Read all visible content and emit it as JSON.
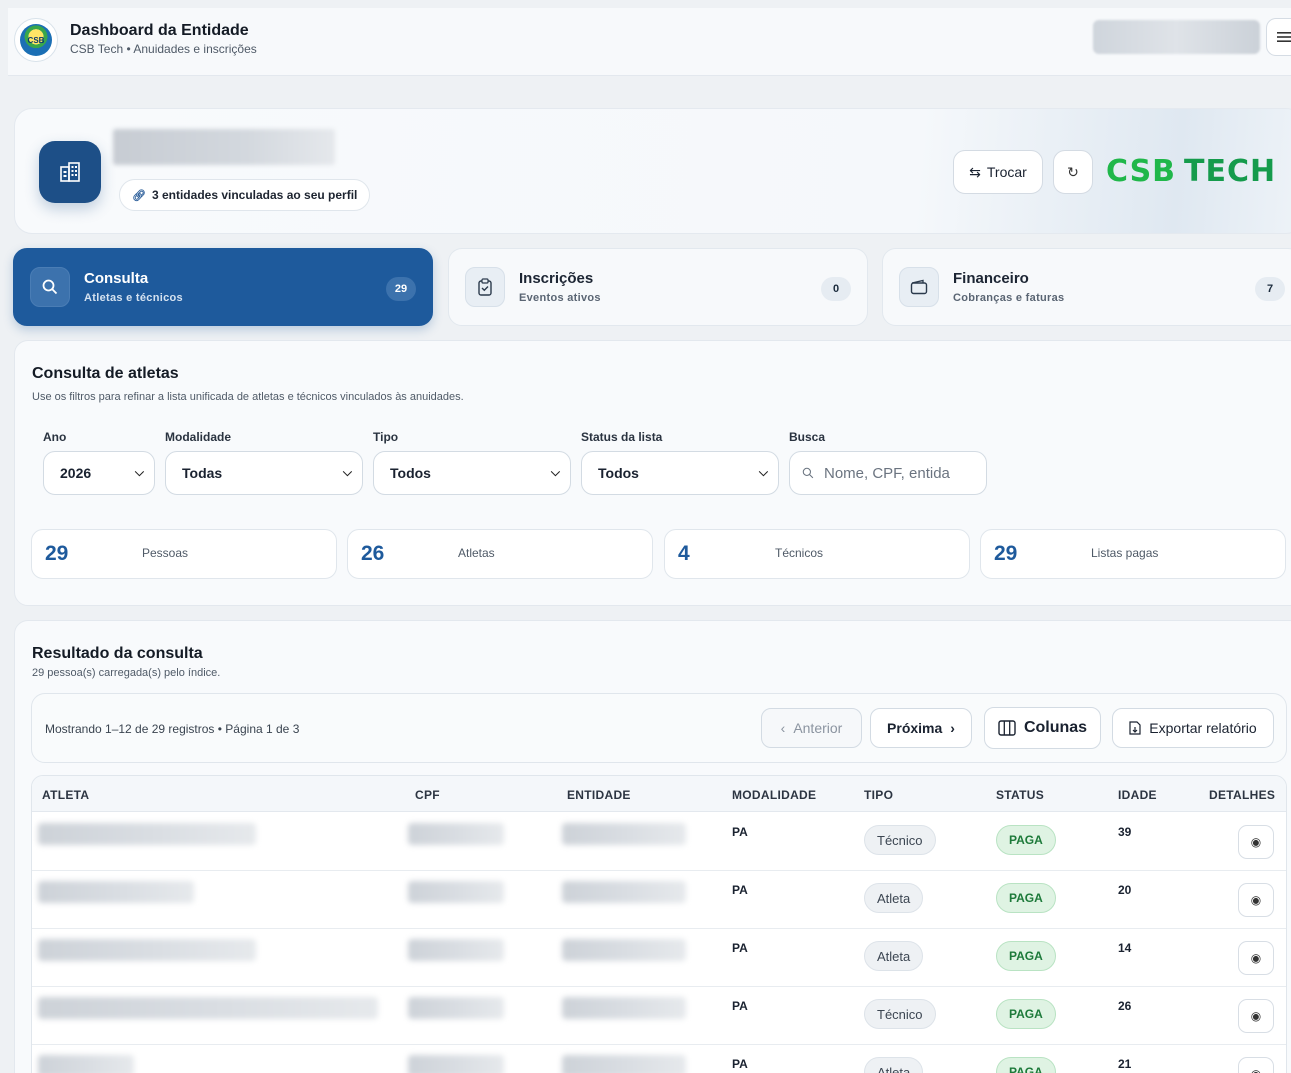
{
  "header": {
    "title": "Dashboard da Entidade",
    "subtitle": "CSB Tech • Anuidades e inscrições",
    "logo_text": "CSB",
    "menu_icon": "hamburger-icon"
  },
  "entity": {
    "linked_label": "3 entidades vinculadas ao seu perfil",
    "switch_label": "Trocar",
    "brand_left": "CSB",
    "brand_right": "TECH",
    "brand_color": "#20b74a"
  },
  "tabs": [
    {
      "title": "Consulta",
      "subtitle": "Atletas e técnicos",
      "count": "29",
      "icon": "search-icon",
      "active": true
    },
    {
      "title": "Inscrições",
      "subtitle": "Eventos ativos",
      "count": "0",
      "icon": "clipboard-check-icon",
      "active": false
    },
    {
      "title": "Financeiro",
      "subtitle": "Cobranças e faturas",
      "count": "7",
      "icon": "wallet-icon",
      "active": false
    }
  ],
  "consulta": {
    "title": "Consulta de atletas",
    "description": "Use os filtros para refinar a lista unificada de atletas e técnicos vinculados às anuidades.",
    "filters": {
      "ano": {
        "label": "Ano",
        "value": "2026"
      },
      "modalidade": {
        "label": "Modalidade",
        "value": "Todas"
      },
      "tipo": {
        "label": "Tipo",
        "value": "Todos"
      },
      "status": {
        "label": "Status da lista",
        "value": "Todos"
      },
      "busca": {
        "label": "Busca",
        "placeholder": "Nome, CPF, entida"
      }
    },
    "stats": [
      {
        "value": "29",
        "label": "Pessoas"
      },
      {
        "value": "26",
        "label": "Atletas"
      },
      {
        "value": "4",
        "label": "Técnicos"
      },
      {
        "value": "29",
        "label": "Listas pagas"
      }
    ]
  },
  "result": {
    "title": "Resultado da consulta",
    "description": "29 pessoa(s) carregada(s) pelo índice.",
    "toolbar": {
      "info": "Mostrando 1–12 de 29 registros • Página 1 de 3",
      "prev_label": "Anterior",
      "next_label": "Próxima",
      "columns_label": "Colunas",
      "export_label": "Exportar relatório"
    },
    "columns": [
      "ATLETA",
      "CPF",
      "ENTIDADE",
      "MODALIDADE",
      "TIPO",
      "STATUS",
      "IDADE",
      "DETALHES"
    ],
    "rows": [
      {
        "modalidade": "PA",
        "tipo": "Técnico",
        "status": "PAGA",
        "idade": "39"
      },
      {
        "modalidade": "PA",
        "tipo": "Atleta",
        "status": "PAGA",
        "idade": "20"
      },
      {
        "modalidade": "PA",
        "tipo": "Atleta",
        "status": "PAGA",
        "idade": "14"
      },
      {
        "modalidade": "PA",
        "tipo": "Técnico",
        "status": "PAGA",
        "idade": "26"
      },
      {
        "modalidade": "PA",
        "tipo": "Atleta",
        "status": "PAGA",
        "idade": "21"
      }
    ]
  }
}
